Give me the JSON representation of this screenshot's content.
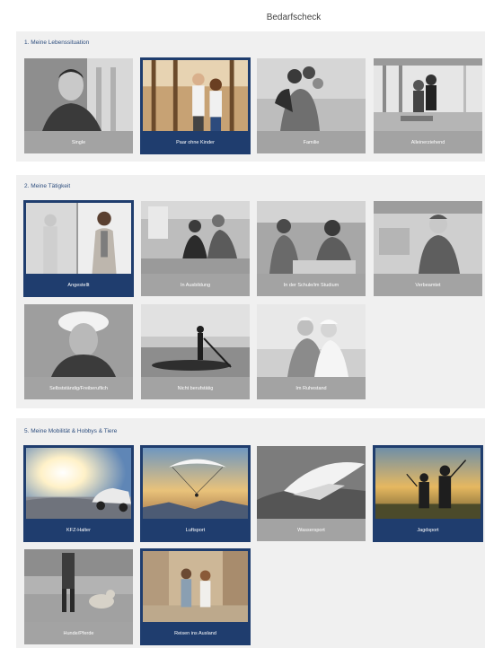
{
  "page": {
    "title": "Bedarfscheck"
  },
  "sections": [
    {
      "title": "1. Meine Lebenssituation",
      "cards": [
        {
          "label": "Single",
          "selected": false
        },
        {
          "label": "Paar ohne Kinder",
          "selected": true
        },
        {
          "label": "Familie",
          "selected": false
        },
        {
          "label": "Alleinerziehend",
          "selected": false
        }
      ]
    },
    {
      "title": "2. Meine Tätigkeit",
      "cards": [
        {
          "label": "Angestellt",
          "selected": true
        },
        {
          "label": "In Ausbildung",
          "selected": false
        },
        {
          "label": "In der Schule/im Studium",
          "selected": false
        },
        {
          "label": "Verbeamtet",
          "selected": false
        },
        {
          "label": "Selbstständig/Freiberuflich",
          "selected": false
        },
        {
          "label": "Nicht berufstätig",
          "selected": false
        },
        {
          "label": "Im Ruhestand",
          "selected": false
        }
      ]
    },
    {
      "title": "5. Meine Mobilität & Hobbys & Tiere",
      "cards": [
        {
          "label": "KFZ-Halter",
          "selected": true
        },
        {
          "label": "Luftsport",
          "selected": true
        },
        {
          "label": "Wassersport",
          "selected": false
        },
        {
          "label": "Jagdsport",
          "selected": true
        },
        {
          "label": "Hunde/Pferde",
          "selected": false
        },
        {
          "label": "Reisen ins Ausland",
          "selected": true
        }
      ]
    }
  ],
  "colors": {
    "selected": "#1f3d6e",
    "unselected": "#a3a3a3",
    "panel": "#f0f0f0",
    "heading": "#2f4f7f"
  }
}
